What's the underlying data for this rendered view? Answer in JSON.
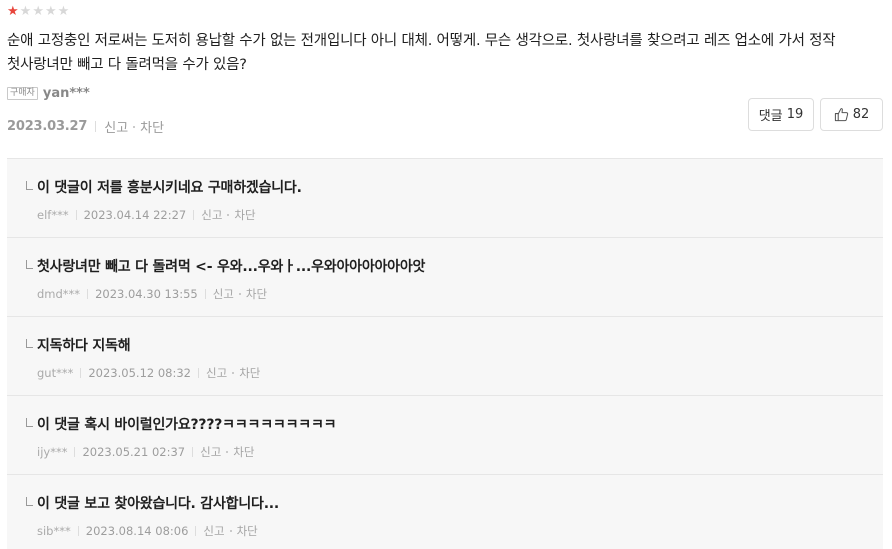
{
  "rating": {
    "filled": 1,
    "total": 5,
    "colors": {
      "filled": "#e8453c",
      "empty": "#d8d8d8"
    }
  },
  "review": {
    "text": "순애 고정충인 저로써는 도저히 용납할 수가 없는 전개입니다 아니 대체. 어떻게. 무슨 생각으로. 첫사랑녀를 찾으려고 레즈 업소에 가서 정작 첫사랑녀만 빼고 다 돌려먹을 수가 있음?",
    "buyer_badge": "구매자",
    "author": "yan***",
    "date": "2023.03.27",
    "report_label": "신고",
    "block_label": "차단"
  },
  "buttons": {
    "comment_label": "댓글",
    "comment_count": "19",
    "like_count": "82",
    "like_icon": "thumbs-up-icon"
  },
  "comments": [
    {
      "text": "이 댓글이 저를 흥분시키네요 구매하겠습니다.",
      "author": "elf***",
      "date": "2023.04.14 22:27",
      "report": "신고",
      "block": "차단"
    },
    {
      "text": "첫사랑녀만 빼고 다 돌려먹 <- 우와...우와ㅏ...우와아아아아아아앗",
      "author": "dmd***",
      "date": "2023.04.30 13:55",
      "report": "신고",
      "block": "차단"
    },
    {
      "text": "지독하다 지독해",
      "author": "gut***",
      "date": "2023.05.12 08:32",
      "report": "신고",
      "block": "차단"
    },
    {
      "text": "이 댓글 혹시 바이럴인가요????ㅋㅋㅋㅋㅋㅋㅋㅋㅋ",
      "author": "ijy***",
      "date": "2023.05.21 02:37",
      "report": "신고",
      "block": "차단"
    },
    {
      "text": "이 댓글 보고 찾아왔습니다. 감사합니다...",
      "author": "sib***",
      "date": "2023.08.14 08:06",
      "report": "신고",
      "block": "차단"
    }
  ]
}
